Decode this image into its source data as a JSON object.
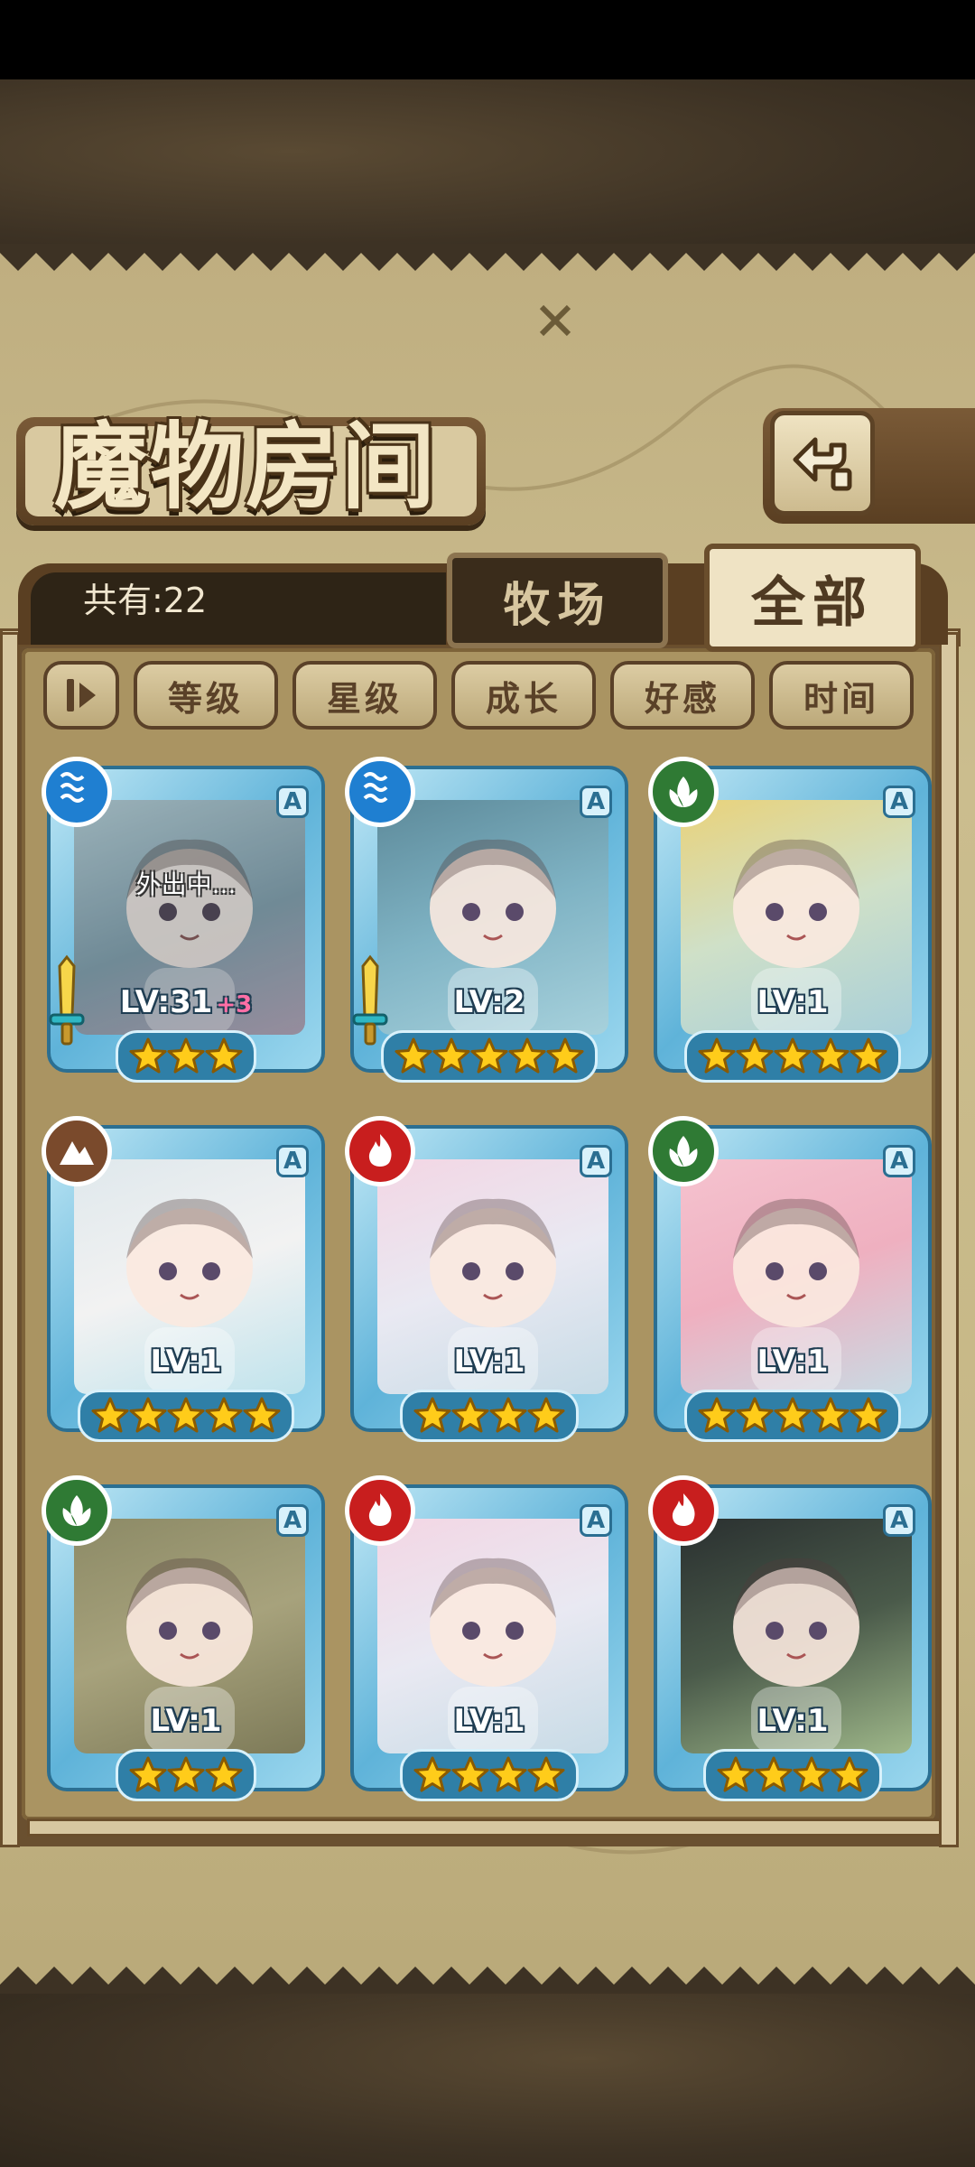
{
  "header": {
    "title": "魔物房间"
  },
  "collection": {
    "count_label": "共有:22"
  },
  "tabs": {
    "ranch": "牧场",
    "all": "全部",
    "active": "全部"
  },
  "filters": {
    "sort_order_icon": "sort-toggle-icon",
    "level": "等级",
    "star": "星级",
    "growth": "成长",
    "affection": "好感",
    "time": "时间"
  },
  "monsters": [
    {
      "element": "water",
      "rank": "A",
      "level": "LV:31",
      "bonus": "+3",
      "stars": 3,
      "status": "外出中...",
      "equipped": true
    },
    {
      "element": "water",
      "rank": "A",
      "level": "LV:2",
      "stars": 5,
      "equipped": true
    },
    {
      "element": "wood",
      "rank": "A",
      "level": "LV:1",
      "stars": 5
    },
    {
      "element": "earth",
      "rank": "A",
      "level": "LV:1",
      "stars": 5
    },
    {
      "element": "fire",
      "rank": "A",
      "level": "LV:1",
      "stars": 4
    },
    {
      "element": "wood",
      "rank": "A",
      "level": "LV:1",
      "stars": 5
    },
    {
      "element": "wood",
      "rank": "A",
      "level": "LV:1",
      "stars": 3
    },
    {
      "element": "fire",
      "rank": "A",
      "level": "LV:1",
      "stars": 4
    },
    {
      "element": "fire",
      "rank": "A",
      "level": "LV:1",
      "stars": 4
    }
  ],
  "colors": {
    "water": "#1f7fd1",
    "wood": "#2f7a34",
    "fire": "#c81e1e",
    "earth": "#7a4a2c",
    "frame": "#5fb3d9",
    "star": "#ffcc1a"
  }
}
